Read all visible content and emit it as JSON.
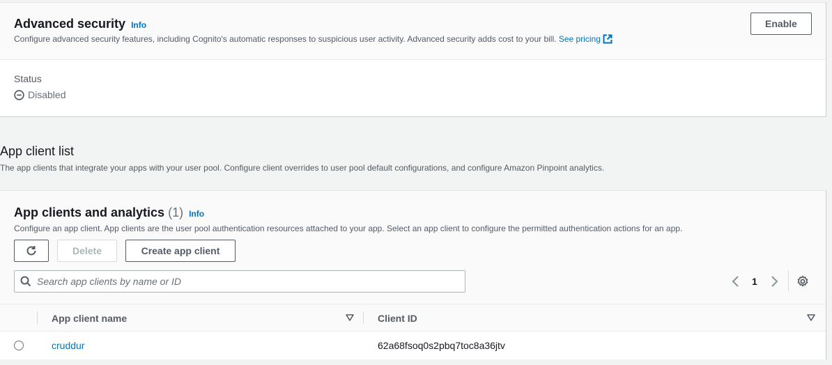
{
  "advanced_security": {
    "title": "Advanced security",
    "info": "Info",
    "description": "Configure advanced security features, including Cognito's automatic responses to suspicious user activity. Advanced security adds cost to your bill.",
    "pricing_link": "See pricing",
    "enable_button": "Enable",
    "status_label": "Status",
    "status_value": "Disabled"
  },
  "app_client_list": {
    "title": "App client list",
    "description": "The app clients that integrate your apps with your user pool. Configure client overrides to user pool default configurations, and configure Amazon Pinpoint analytics."
  },
  "app_clients": {
    "title": "App clients and analytics",
    "count": "(1)",
    "info": "Info",
    "description": "Configure an app client. App clients are the user pool authentication resources attached to your app. Select an app client to configure the permitted authentication actions for an app.",
    "delete_button": "Delete",
    "create_button": "Create app client",
    "search_placeholder": "Search app clients by name or ID",
    "page": "1",
    "columns": [
      "App client name",
      "Client ID"
    ],
    "rows": [
      {
        "name": "cruddur",
        "client_id": "62a68fsoq0s2pbq7toc8a36jtv"
      }
    ]
  },
  "colors": {
    "link": "#0073bb",
    "background": "#f2f3f3",
    "border": "#545b64"
  }
}
